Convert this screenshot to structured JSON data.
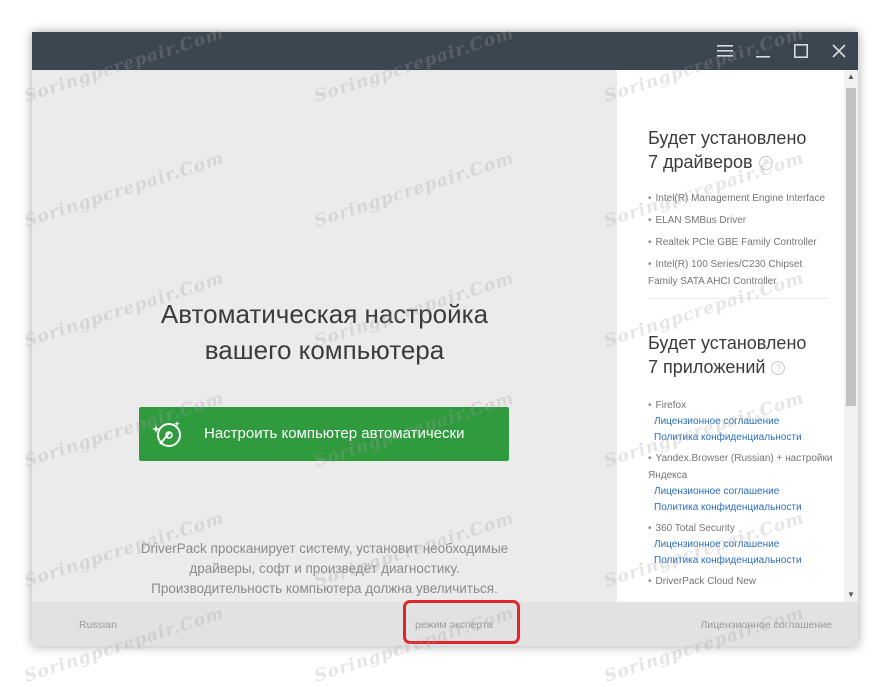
{
  "window": {
    "titlebar": {
      "menu_icon": "hamburger-icon",
      "minimize_icon": "minimize-icon",
      "maximize_icon": "maximize-icon",
      "close_icon": "close-icon"
    }
  },
  "main": {
    "headline_line1": "Автоматическая настройка",
    "headline_line2": "вашего компьютера",
    "cta_label": "Настроить компьютер автоматически",
    "cta_icon": "disc-magic-icon",
    "desc_line1": "DriverPack просканирует систему, установит необходимые",
    "desc_line2": "драйверы, софт и произведёт диагностику.",
    "desc_line3": "Производительность компьютера должна увеличиться."
  },
  "sidebar": {
    "drivers_heading_line1": "Будет установлено",
    "drivers_heading_line2": "7 драйверов",
    "drivers": [
      "Intel(R) Management Engine Interface",
      "ELAN SMBus Driver",
      "Realtek PCIe GBE Family Controller",
      "Intel(R) 100 Series/C230 Chipset Family SATA AHCI Controller"
    ],
    "apps_heading_line1": "Будет установлено",
    "apps_heading_line2": "7 приложений",
    "help_glyph": "?",
    "bullet": "•",
    "apps": [
      {
        "name": "Firefox",
        "link1": "Лицензионное соглашение",
        "link2": "Политика конфиденциальности"
      },
      {
        "name": "Yandex.Browser (Russian) + настройки Яндекса",
        "link1": "Лицензионное соглашение",
        "link2": "Политика конфиденциальности"
      },
      {
        "name": "360 Total Security",
        "link1": "Лицензионное соглашение",
        "link2": "Политика конфиденциальности"
      },
      {
        "name": "DriverPack Cloud New"
      }
    ]
  },
  "footer": {
    "language": "Russian",
    "expert_mode": "режим эксперта",
    "license": "Лицензионное соглашение"
  },
  "watermark": "Soringpcrepair.Com",
  "colors": {
    "titlebar": "#3c4650",
    "cta": "#2f9a3e",
    "link": "#2a6fbd",
    "highlight": "#e0252b"
  }
}
